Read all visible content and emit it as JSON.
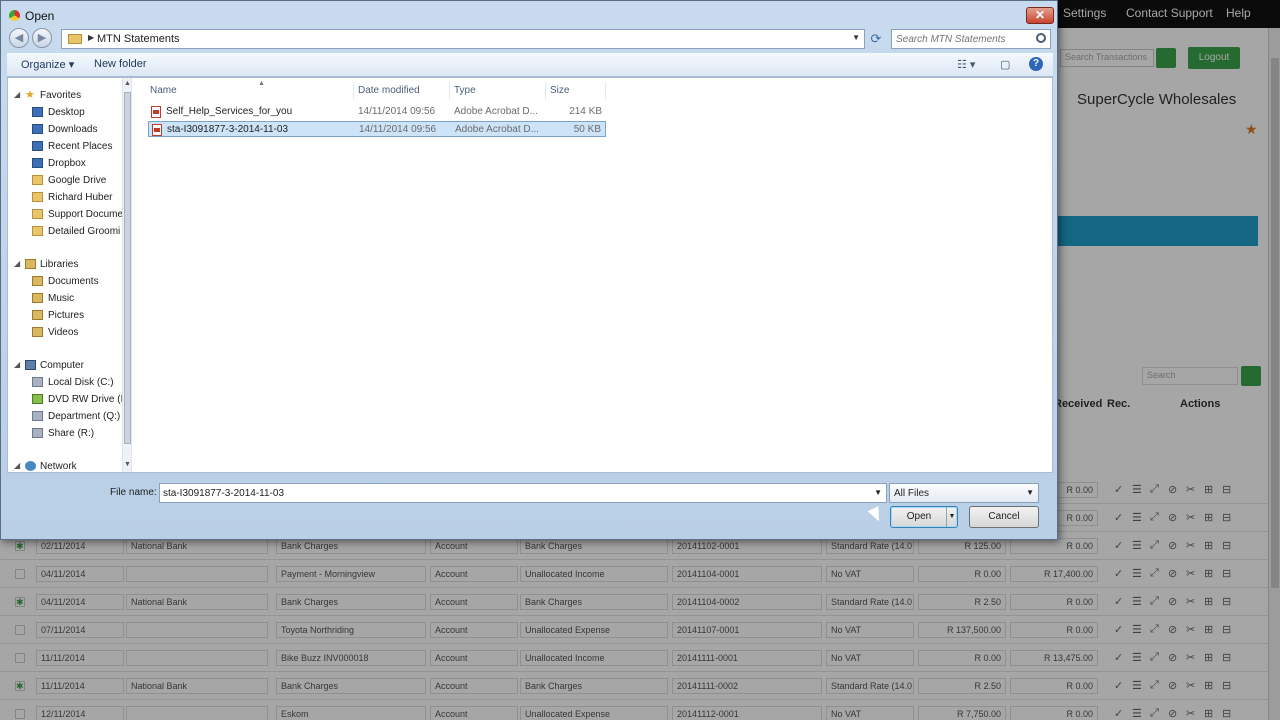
{
  "background": {
    "topnav": [
      "Settings",
      "Contact Support",
      "Help"
    ],
    "search_placeholder": "Search Transactions",
    "logout_label": "Logout",
    "company_name": "SuperCycle Wholesales",
    "table_search_placeholder": "Search",
    "headers": {
      "received": "Received",
      "rec": "Rec.",
      "actions": "Actions"
    },
    "rows": [
      {
        "checked": false,
        "date": "",
        "bank": "",
        "desc": "",
        "type": "",
        "cat": "",
        "ref": "",
        "vat": "",
        "spent": "",
        "received": "R 0.00"
      },
      {
        "checked": false,
        "date": "",
        "bank": "",
        "desc": "",
        "type": "",
        "cat": "",
        "ref": "",
        "vat": "",
        "spent": "",
        "received": "R 0.00"
      },
      {
        "checked": true,
        "date": "02/11/2014",
        "bank": "National Bank",
        "desc": "Bank Charges",
        "type": "Account",
        "cat": "Bank Charges",
        "ref": "20141102-0001",
        "vat": "Standard Rate (14.0",
        "spent": "R 125.00",
        "received": "R 0.00"
      },
      {
        "checked": false,
        "date": "04/11/2014",
        "bank": "",
        "desc": "Payment - Morningview",
        "type": "Account",
        "cat": "Unallocated Income",
        "ref": "20141104-0001",
        "vat": "No VAT",
        "spent": "R 0.00",
        "received": "R 17,400.00"
      },
      {
        "checked": true,
        "date": "04/11/2014",
        "bank": "National Bank",
        "desc": "Bank Charges",
        "type": "Account",
        "cat": "Bank Charges",
        "ref": "20141104-0002",
        "vat": "Standard Rate (14.0",
        "spent": "R 2.50",
        "received": "R 0.00"
      },
      {
        "checked": false,
        "date": "07/11/2014",
        "bank": "",
        "desc": "Toyota Northriding",
        "type": "Account",
        "cat": "Unallocated Expense",
        "ref": "20141107-0001",
        "vat": "No VAT",
        "spent": "R 137,500.00",
        "received": "R 0.00"
      },
      {
        "checked": false,
        "date": "11/11/2014",
        "bank": "",
        "desc": "Bike Buzz INV000018",
        "type": "Account",
        "cat": "Unallocated Income",
        "ref": "20141111-0001",
        "vat": "No VAT",
        "spent": "R 0.00",
        "received": "R 13,475.00"
      },
      {
        "checked": true,
        "date": "11/11/2014",
        "bank": "National Bank",
        "desc": "Bank Charges",
        "type": "Account",
        "cat": "Bank Charges",
        "ref": "20141111-0002",
        "vat": "Standard Rate (14.0",
        "spent": "R 2.50",
        "received": "R 0.00"
      },
      {
        "checked": false,
        "date": "12/11/2014",
        "bank": "",
        "desc": "Eskom",
        "type": "Account",
        "cat": "Unallocated Expense",
        "ref": "20141112-0001",
        "vat": "No VAT",
        "spent": "R 7,750.00",
        "received": "R 0.00"
      }
    ]
  },
  "dialog": {
    "title": "Open",
    "close_label": "✕",
    "address_path": "MTN Statements",
    "search_placeholder": "Search MTN Statements",
    "toolbar": {
      "organize": "Organize ▾",
      "new_folder": "New folder"
    },
    "nav": {
      "favorites_label": "Favorites",
      "favorites": [
        "Desktop",
        "Downloads",
        "Recent Places",
        "Dropbox",
        "Google Drive",
        "Richard Huber",
        "Support Docume",
        "Detailed Groomi"
      ],
      "libraries_label": "Libraries",
      "libraries": [
        "Documents",
        "Music",
        "Pictures",
        "Videos"
      ],
      "computer_label": "Computer",
      "computer": [
        "Local Disk (C:)",
        "DVD RW Drive (D",
        "Department (Q:)",
        "Share (R:)"
      ],
      "network_label": "Network"
    },
    "columns": {
      "name": "Name",
      "date": "Date modified",
      "type": "Type",
      "size": "Size"
    },
    "files": [
      {
        "name": "Self_Help_Services_for_you",
        "date": "14/11/2014 09:56",
        "type": "Adobe Acrobat D...",
        "size": "214 KB",
        "selected": false
      },
      {
        "name": "sta-I3091877-3-2014-11-03",
        "date": "14/11/2014 09:56",
        "type": "Adobe Acrobat D...",
        "size": "50 KB",
        "selected": true
      }
    ],
    "file_name_label": "File name:",
    "file_name_value": "sta-I3091877-3-2014-11-03",
    "filter_value": "All Files",
    "open_label": "Open",
    "cancel_label": "Cancel"
  }
}
